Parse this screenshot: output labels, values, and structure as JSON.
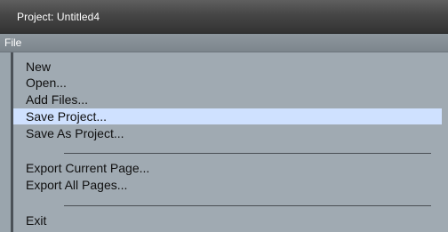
{
  "window": {
    "title": "Project: Untitled4"
  },
  "menubar": {
    "file_label": "File"
  },
  "menu": {
    "items": [
      {
        "label": "New"
      },
      {
        "label": "Open..."
      },
      {
        "label": "Add Files..."
      },
      {
        "label": "Save Project...",
        "highlighted": true
      },
      {
        "label": "Save As Project..."
      },
      {
        "label": "Export Current Page..."
      },
      {
        "label": "Export All Pages..."
      },
      {
        "label": "Exit"
      }
    ]
  },
  "colors": {
    "titlebar": "#3d3d3d",
    "menubar": "#848d94",
    "menu_background": "#a0aab2",
    "highlight": "#cfe1ff",
    "text": "#0f0f0f"
  }
}
